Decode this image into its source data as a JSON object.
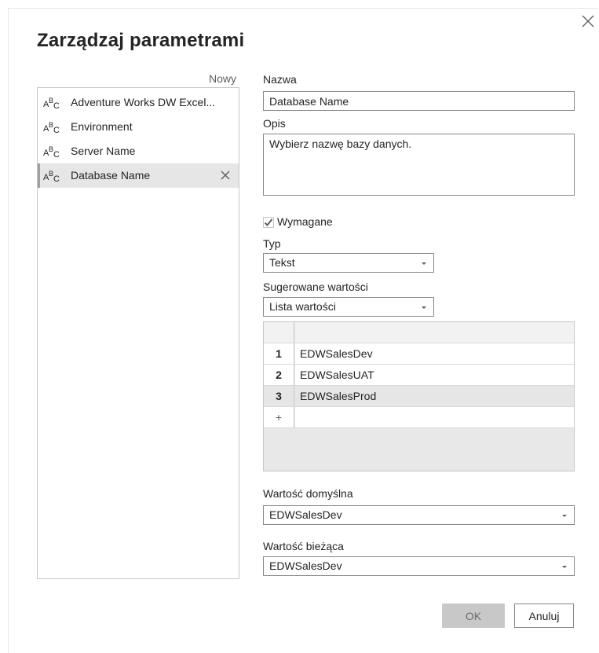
{
  "dialog": {
    "title": "Zarządzaj parametrami",
    "new_label": "Nowy"
  },
  "parameters": [
    {
      "label": "Adventure Works DW Excel...",
      "icon": "text-type-icon"
    },
    {
      "label": "Environment",
      "icon": "text-type-icon"
    },
    {
      "label": "Server Name",
      "icon": "text-type-icon"
    },
    {
      "label": "Database Name",
      "icon": "text-type-icon",
      "selected": true
    }
  ],
  "form": {
    "name_label": "Nazwa",
    "name_value": "Database Name",
    "description_label": "Opis",
    "description_value": "Wybierz nazwę bazy danych.",
    "required_label": "Wymagane",
    "required_checked": true,
    "type_label": "Typ",
    "type_value": "Tekst",
    "suggested_label": "Sugerowane wartości",
    "suggested_value": "Lista wartości",
    "values_table": {
      "rows": [
        {
          "num": "1",
          "value": "EDWSalesDev"
        },
        {
          "num": "2",
          "value": "EDWSalesUAT"
        },
        {
          "num": "3",
          "value": "EDWSalesProd"
        }
      ],
      "add_symbol": "+"
    },
    "default_label": "Wartość domyślna",
    "default_value": "EDWSalesDev",
    "current_label": "Wartość bieżąca",
    "current_value": "EDWSalesDev"
  },
  "buttons": {
    "ok": "OK",
    "cancel": "Anuluj"
  },
  "colors": {
    "border": "#8a8886",
    "selected_bg": "#e6e6e6",
    "ok_disabled_bg": "#c8c8c8"
  }
}
